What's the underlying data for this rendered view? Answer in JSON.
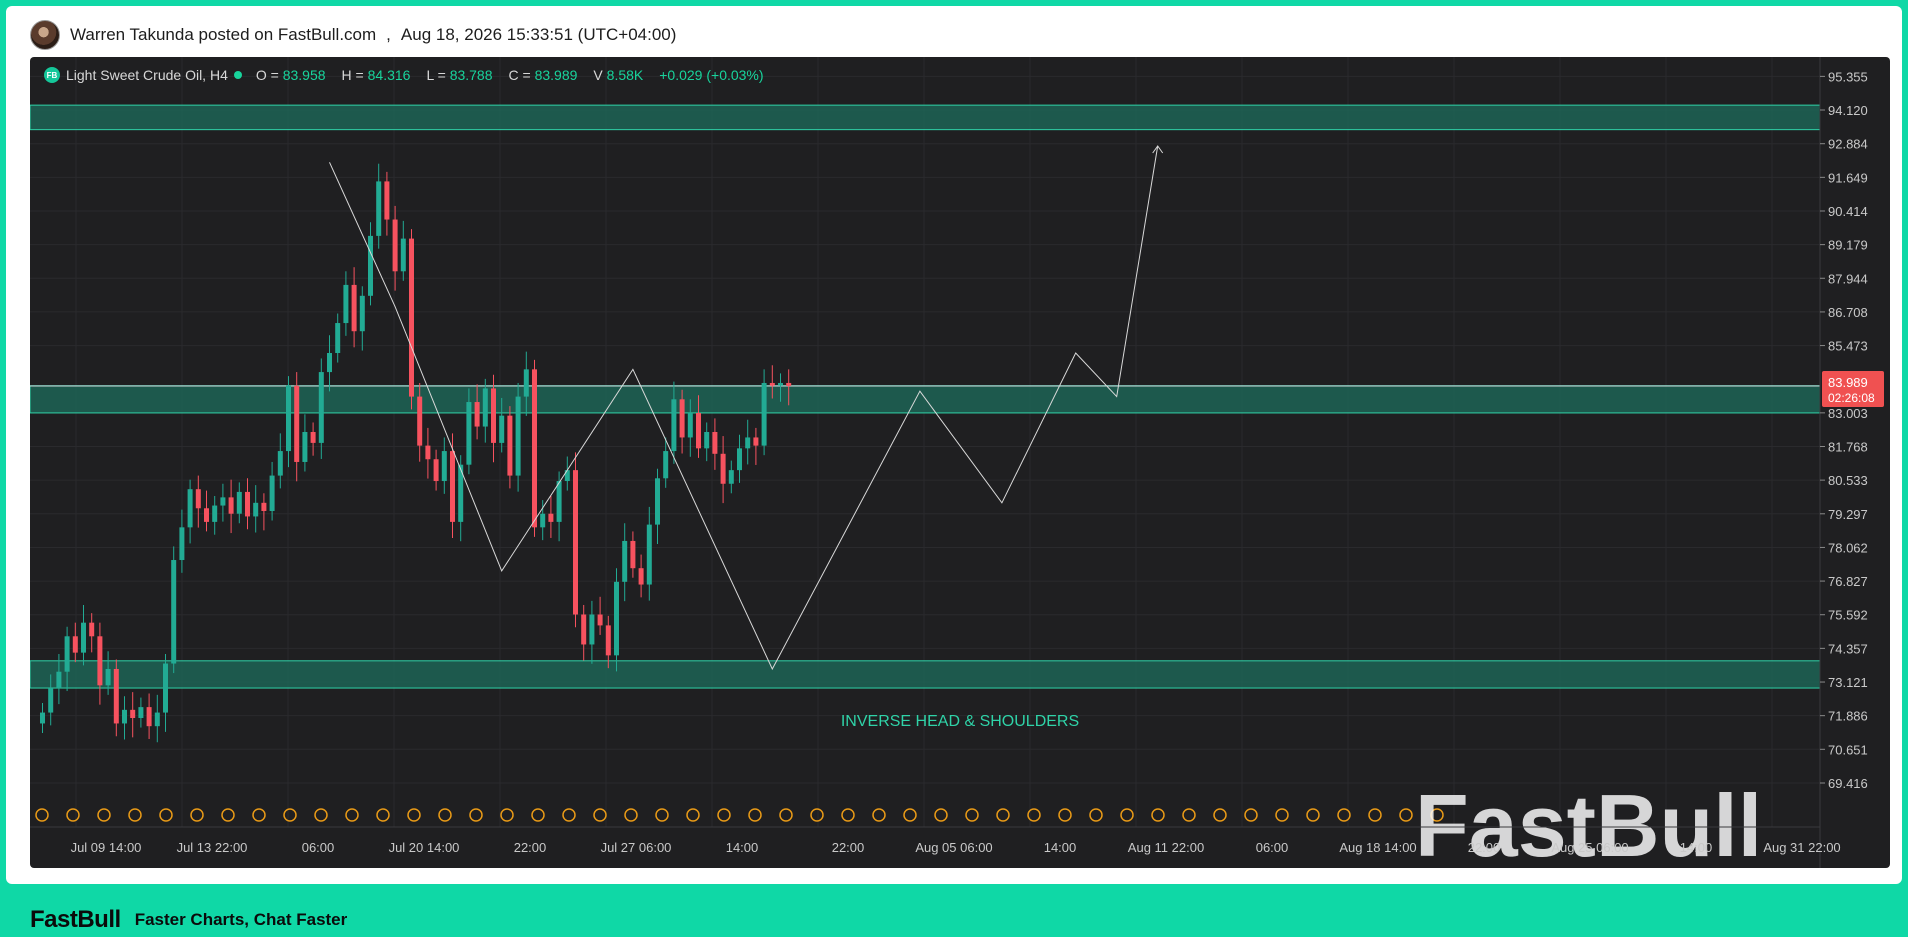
{
  "post": {
    "author_line": "Warren Takunda posted on FastBull.com",
    "separator": ",",
    "timestamp": "Aug 18, 2026 15:33:51 (UTC+04:00)"
  },
  "legend": {
    "badge": "FB",
    "symbol": "Light Sweet Crude Oil, H4",
    "open_label": "O =",
    "open_value": "83.958",
    "high_label": "H =",
    "high_value": "84.316",
    "low_label": "L =",
    "low_value": "83.788",
    "close_label": "C =",
    "close_value": "83.989",
    "volume_label": "V",
    "volume_value": "8.58K",
    "change": "+0.029 (+0.03%)"
  },
  "price_tag": {
    "price": "83.989",
    "countdown": "02:26:08"
  },
  "annotation": "INVERSE HEAD & SHOULDERS",
  "watermark": "FastBull",
  "footer": {
    "logo": "FastBull",
    "tagline": "Faster Charts, Chat Faster"
  },
  "colors": {
    "accent": "#0fd8a6",
    "up": "#22ab94",
    "down": "#f7525f",
    "zone": "#1e6e5c",
    "price_tag": "#f05151"
  },
  "chart_data": {
    "type": "candlestick",
    "timeframe": "H4",
    "y_ticks": [
      "95.355",
      "94.120",
      "92.884",
      "91.649",
      "90.414",
      "89.179",
      "87.944",
      "86.708",
      "85.473",
      "83.003",
      "81.768",
      "80.533",
      "79.297",
      "78.062",
      "76.827",
      "75.592",
      "74.357",
      "73.121",
      "71.886",
      "70.651",
      "69.416"
    ],
    "ylim": [
      68.9,
      95.7
    ],
    "x_ticks": [
      "Jul 09 14:00",
      "Jul 13 22:00",
      "06:00",
      "Jul 20 14:00",
      "22:00",
      "Jul 27 06:00",
      "14:00",
      "22:00",
      "Aug 05 06:00",
      "14:00",
      "Aug 11 22:00",
      "06:00",
      "Aug 18 14:00",
      "22:00",
      "Aug 25 06:00",
      "14:00",
      "Aug 31 22:00"
    ],
    "support_zones": [
      {
        "from": 93.4,
        "to": 94.3
      },
      {
        "from": 83.0,
        "to": 84.0
      },
      {
        "from": 72.9,
        "to": 73.9
      }
    ],
    "last_price": 83.989,
    "pattern_path": [
      [
        35,
        92.2
      ],
      [
        43,
        86.9
      ],
      [
        56,
        77.2
      ],
      [
        72,
        84.6
      ],
      [
        89,
        73.6
      ],
      [
        107,
        83.8
      ],
      [
        117,
        79.7
      ],
      [
        126,
        85.2
      ],
      [
        131,
        83.6
      ],
      [
        136,
        92.8
      ]
    ],
    "closes": [
      72.0,
      72.9,
      73.5,
      74.8,
      74.2,
      75.3,
      74.8,
      73.0,
      73.6,
      71.6,
      72.1,
      71.8,
      72.2,
      71.5,
      72.0,
      73.8,
      77.6,
      78.8,
      80.2,
      79.5,
      79.0,
      79.6,
      79.9,
      79.3,
      80.1,
      79.2,
      79.7,
      79.4,
      80.7,
      81.6,
      84.0,
      81.2,
      82.3,
      81.9,
      84.5,
      85.2,
      86.3,
      87.7,
      86.0,
      87.3,
      89.5,
      91.5,
      90.1,
      88.2,
      89.4,
      83.6,
      81.8,
      81.3,
      80.5,
      81.6,
      79.0,
      81.1,
      83.4,
      82.5,
      83.9,
      81.9,
      82.9,
      80.7,
      83.6,
      84.6,
      78.8,
      79.3,
      79.0,
      80.5,
      80.9,
      75.6,
      74.5,
      75.6,
      75.2,
      74.1,
      76.8,
      78.3,
      77.3,
      76.7,
      78.9,
      80.6,
      81.6,
      83.5,
      82.1,
      83.0,
      81.7,
      82.3,
      81.5,
      80.4,
      80.9,
      81.7,
      82.1,
      81.8,
      84.1,
      84.0,
      84.1,
      83.99
    ]
  }
}
